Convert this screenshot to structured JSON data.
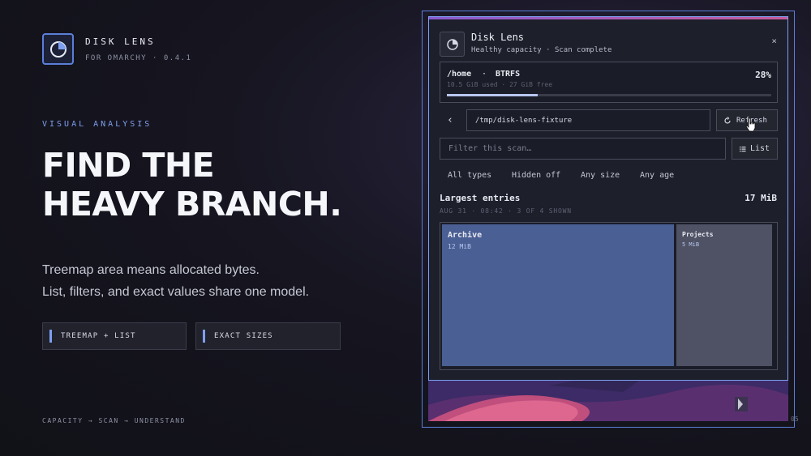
{
  "brand": {
    "name": "DISK LENS",
    "subtitle": "FOR OMARCHY · 0.4.1"
  },
  "hero": {
    "eyebrow": "VISUAL ANALYSIS",
    "headline_line1": "FIND THE",
    "headline_line2": "HEAVY BRANCH.",
    "desc_line1": "Treemap area means allocated bytes.",
    "desc_line2": "List, filters, and exact values share one model.",
    "pills": [
      "TREEMAP + LIST",
      "EXACT SIZES"
    ],
    "footer": "CAPACITY → SCAN → UNDERSTAND"
  },
  "app": {
    "title": "Disk Lens",
    "status": "Healthy capacity · Scan complete",
    "close_icon": "×",
    "disk": {
      "mount": "/home",
      "separator": "·",
      "fs": "BTRFS",
      "usage": "10.5 GiB used  ·  27 GiB free",
      "percent_label": "28%",
      "percent": 0.28
    },
    "back_icon": "‹",
    "path": "/tmp/disk-lens-fixture",
    "refresh_label": "Refresh",
    "filter_placeholder": "Filter this scan…",
    "list_label": "List",
    "filters": [
      "All types",
      "Hidden off",
      "Any size",
      "Any age"
    ],
    "section": {
      "title": "Largest entries",
      "total": "17 MiB",
      "meta": "AUG 31  ·  08:42  ·  3 OF 4 SHOWN"
    },
    "treemap": [
      {
        "name": "Archive",
        "size": "12 MiB",
        "color": "#4a5f93"
      },
      {
        "name": "Projects",
        "size": "5 MiB",
        "color": "#4f5264"
      }
    ]
  },
  "version_fragment": "05",
  "colors": {
    "accent": "#7d9ff0",
    "frame": "#5b7fd8",
    "archive": "#4a5f93",
    "projects": "#4f5264"
  }
}
